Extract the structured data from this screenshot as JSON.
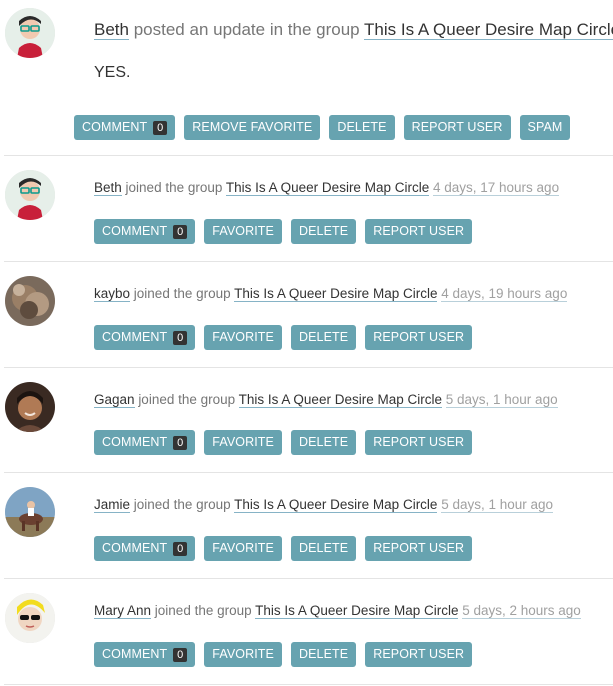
{
  "first": {
    "user": "Beth",
    "action": "posted an update in the group",
    "group": "This Is A Queer Desire Map Circle",
    "content": "YES.",
    "buttons": {
      "comment": "COMMENT",
      "comment_count": "0",
      "remove_favorite": "REMOVE FAVORITE",
      "delete": "DELETE",
      "report": "REPORT USER",
      "spam": "SPAM"
    }
  },
  "items": [
    {
      "user": "Beth",
      "action": "joined the group",
      "group": "This Is A Queer Desire Map Circle",
      "time": "4 days, 17 hours ago"
    },
    {
      "user": "kaybo",
      "action": "joined the group",
      "group": "This Is A Queer Desire Map Circle",
      "time": "4 days, 19 hours ago"
    },
    {
      "user": "Gagan",
      "action": "joined the group",
      "group": "This Is A Queer Desire Map Circle",
      "time": "5 days, 1 hour ago"
    },
    {
      "user": "Jamie",
      "action": "joined the group",
      "group": "This Is A Queer Desire Map Circle",
      "time": "5 days, 1 hour ago"
    },
    {
      "user": "Mary Ann",
      "action": "joined the group",
      "group": "This Is A Queer Desire Map Circle",
      "time": "5 days, 2 hours ago"
    }
  ],
  "item_buttons": {
    "comment": "COMMENT",
    "comment_count": "0",
    "favorite": "FAVORITE",
    "delete": "DELETE",
    "report": "REPORT USER"
  },
  "colors": {
    "button": "#67a3b0",
    "count_badge": "#333333",
    "link_underline": "#86b3c6"
  }
}
